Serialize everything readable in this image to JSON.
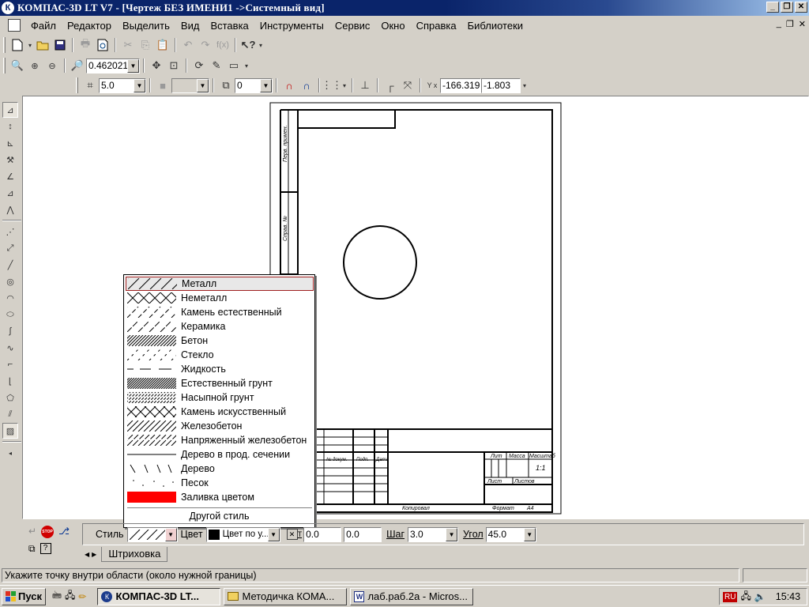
{
  "window": {
    "title": "КОМПАС-3D LT V7 - [Чертеж БЕЗ ИМЕНИ1 ->Системный вид]",
    "app_icon": "К"
  },
  "menubar": {
    "items": [
      "Файл",
      "Редактор",
      "Выделить",
      "Вид",
      "Вставка",
      "Инструменты",
      "Сервис",
      "Окно",
      "Справка",
      "Библиотеки"
    ]
  },
  "toolbar_view": {
    "zoom_value": "0.462021"
  },
  "toolbar_current": {
    "step_value": "5.0",
    "layer_value": "0",
    "coord_x": "-166.319",
    "coord_y": "-1.803",
    "coord_axes_label": "Y x"
  },
  "drawing": {
    "frame_labels": {
      "stamp_lit": "Лит",
      "stamp_mass": "Масса",
      "stamp_scale": "Масштаб",
      "stamp_scale_value": "1:1",
      "stamp_sheet": "Лист",
      "stamp_sheets": "Листов",
      "copied": "Копировал",
      "format": "Формат",
      "format_value": "A4",
      "col_doc": "№ докум.",
      "col_sign": "Подп.",
      "col_date": "Дата",
      "side_perv": "Перв. примен.",
      "side_sprav": "Справ. №"
    }
  },
  "hatch_popup": {
    "items": [
      {
        "label": "Металл",
        "pattern": "metal",
        "selected": true
      },
      {
        "label": "Неметалл",
        "pattern": "nonmetal"
      },
      {
        "label": "Камень естественный",
        "pattern": "stone-natural"
      },
      {
        "label": "Керамика",
        "pattern": "ceramic"
      },
      {
        "label": "Бетон",
        "pattern": "concrete"
      },
      {
        "label": "Стекло",
        "pattern": "glass"
      },
      {
        "label": "Жидкость",
        "pattern": "liquid"
      },
      {
        "label": "Естественный грунт",
        "pattern": "ground-natural"
      },
      {
        "label": "Насыпной грунт",
        "pattern": "ground-bulk"
      },
      {
        "label": "Камень искусственный",
        "pattern": "stone-artificial"
      },
      {
        "label": "Железобетон",
        "pattern": "reinforced-concrete"
      },
      {
        "label": "Напряженный железобетон",
        "pattern": "prestressed-concrete"
      },
      {
        "label": "Дерево в прод. сечении",
        "pattern": "wood-long"
      },
      {
        "label": "Дерево",
        "pattern": "wood"
      },
      {
        "label": "Песок",
        "pattern": "sand"
      },
      {
        "label": "Заливка цветом",
        "pattern": "fill",
        "color": "#ff0000"
      }
    ],
    "other_label": "Другой стиль"
  },
  "propbar": {
    "style_label": "Стиль",
    "color_label": "Цвет",
    "color_value": "Цвет по у...",
    "color_swatch": "#000000",
    "x_label": "Т",
    "x_value": "0.0",
    "y_value": "0.0",
    "step_label": "Шаг",
    "step_value": "3.0",
    "angle_label": "Угол",
    "angle_value": "45.0",
    "tab_label": "Штриховка"
  },
  "status": {
    "text": "Укажите точку внутри области (около нужной границы)"
  },
  "taskbar": {
    "start_label": "Пуск",
    "tasks": [
      {
        "label": "КОМПАС-3D LT...",
        "icon": "kompas-icon",
        "active": true
      },
      {
        "label": "Методичка КОМА...",
        "icon": "folder-icon"
      },
      {
        "label": "лаб.раб.2а - Micros...",
        "icon": "word-icon"
      }
    ],
    "lang": "RU",
    "clock": "15:43"
  }
}
